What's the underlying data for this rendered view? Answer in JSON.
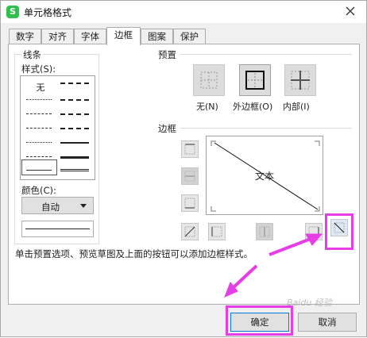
{
  "window": {
    "title": "单元格格式",
    "app_icon_letter": "S"
  },
  "tabs": [
    {
      "label": "数字"
    },
    {
      "label": "对齐"
    },
    {
      "label": "字体"
    },
    {
      "label": "边框",
      "active": true
    },
    {
      "label": "图案"
    },
    {
      "label": "保护"
    }
  ],
  "line_group": {
    "title": "线条",
    "style_label": "样式(S):",
    "style_none": "无",
    "color_label": "颜色(C):",
    "color_value": "自动"
  },
  "preset_group": {
    "title": "预置",
    "items": [
      {
        "label": "无(N)"
      },
      {
        "label": "外边框(O)"
      },
      {
        "label": "内部(I)"
      }
    ]
  },
  "border_group": {
    "title": "边框",
    "preview_text": "文本"
  },
  "hint_text": "单击预置选项、预览草图及上面的按钮可以添加边框样式。",
  "buttons": {
    "ok": "确定",
    "cancel": "取消"
  },
  "colors": {
    "highlight": "#e63ee6",
    "accent_border": "#0078d7",
    "panel_bg": "#ffffff",
    "dialog_bg": "#f0f0f0"
  }
}
